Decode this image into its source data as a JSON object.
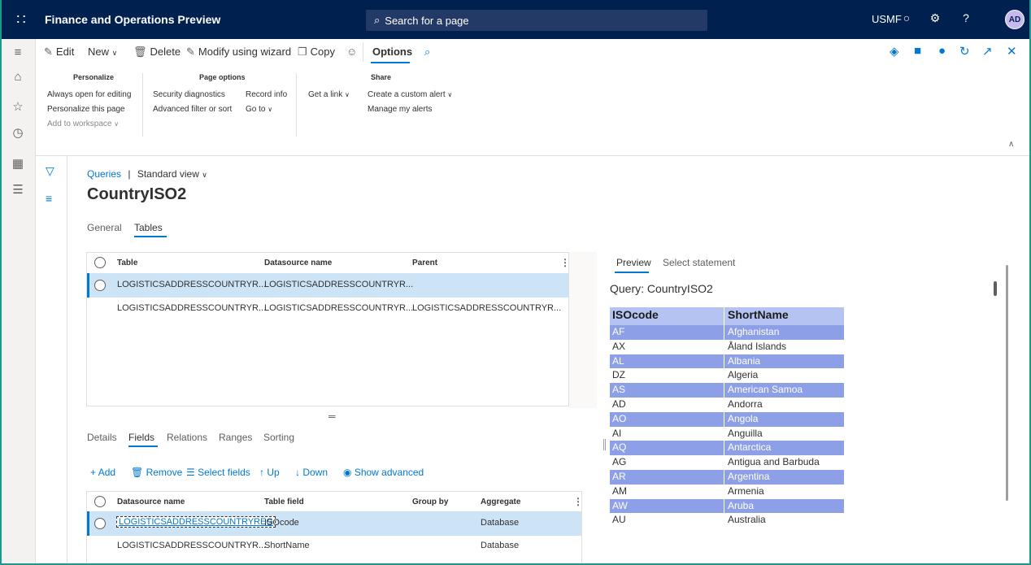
{
  "topbar": {
    "app_title": "Finance and Operations Preview",
    "search_placeholder": "Search for a page",
    "company": "USMF",
    "avatar": "AD",
    "accent": "#002050"
  },
  "actionpane": {
    "edit": "Edit",
    "new": "New",
    "delete": "Delete",
    "modify": "Modify using wizard",
    "copy": "Copy",
    "options_tab": "Options",
    "badge": "0",
    "groups": {
      "personalize": {
        "title": "Personalize",
        "items": [
          "Always open for editing",
          "Personalize this page",
          "Add to workspace"
        ]
      },
      "page_options": {
        "title": "Page options",
        "security": "Security diagnostics",
        "record_info": "Record info",
        "advanced": "Advanced filter or sort",
        "goto": "Go to"
      },
      "share": {
        "title": "Share",
        "get_link": "Get a link",
        "create_alert": "Create a custom alert",
        "manage_alerts": "Manage my alerts"
      }
    }
  },
  "main": {
    "breadcrumb_link": "Queries",
    "breadcrumb_sep": "|",
    "view": "Standard view",
    "title": "CountryISO2",
    "tabs": [
      "General",
      "Tables"
    ],
    "tables_grid": {
      "headers": [
        "Table",
        "Datasource name",
        "Parent"
      ],
      "rows": [
        [
          "LOGISTICSADDRESSCOUNTRYR...",
          "LOGISTICSADDRESSCOUNTRYR...",
          ""
        ],
        [
          "LOGISTICSADDRESSCOUNTRYR...",
          "LOGISTICSADDRESSCOUNTRYR...",
          "LOGISTICSADDRESSCOUNTRYR..."
        ]
      ]
    },
    "detail_tabs": [
      "Details",
      "Fields",
      "Relations",
      "Ranges",
      "Sorting"
    ],
    "fields_toolbar": {
      "add": "Add",
      "remove": "Remove",
      "select_fields": "Select fields",
      "up": "Up",
      "down": "Down",
      "show_advanced": "Show advanced"
    },
    "fields_grid": {
      "headers": [
        "Datasource name",
        "Table field",
        "Group by",
        "Aggregate"
      ],
      "rows": [
        [
          "LOGISTICSADDRESSCOUNTRYREG",
          "ISOcode",
          "",
          "Database"
        ],
        [
          "LOGISTICSADDRESSCOUNTRYR...",
          "ShortName",
          "",
          "Database"
        ]
      ]
    }
  },
  "preview": {
    "tabs": [
      "Preview",
      "Select statement"
    ],
    "query_label": "Query: CountryISO2",
    "headers": [
      "ISOcode",
      "ShortName"
    ],
    "rows": [
      [
        "AF",
        "Afghanistan"
      ],
      [
        "AX",
        "Åland Islands"
      ],
      [
        "AL",
        "Albania"
      ],
      [
        "DZ",
        "Algeria"
      ],
      [
        "AS",
        "American Samoa"
      ],
      [
        "AD",
        "Andorra"
      ],
      [
        "AO",
        "Angola"
      ],
      [
        "AI",
        "Anguilla"
      ],
      [
        "AQ",
        "Antarctica"
      ],
      [
        "AG",
        "Antigua and Barbuda"
      ],
      [
        "AR",
        "Argentina"
      ],
      [
        "AM",
        "Armenia"
      ],
      [
        "AW",
        "Aruba"
      ],
      [
        "AU",
        "Australia"
      ]
    ]
  }
}
